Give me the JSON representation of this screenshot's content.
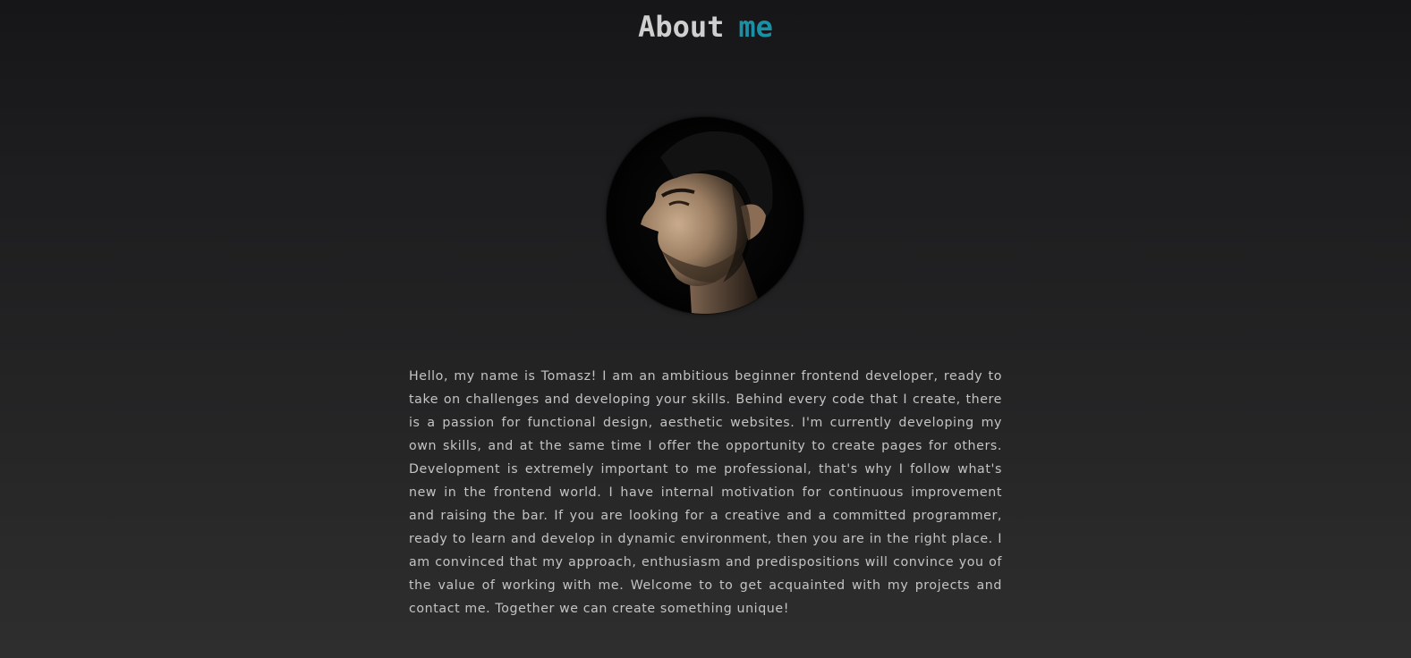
{
  "header": {
    "title_main": "About",
    "title_accent": "me"
  },
  "colors": {
    "accent": "#1a8fa6",
    "title": "#cfcfcf",
    "text": "#c4c4c4",
    "background_top": "#161618",
    "background_bottom": "#2e2e2e"
  },
  "portrait": {
    "icon": "profile-photo"
  },
  "bio": {
    "text": "Hello, my name is Tomasz! I am an ambitious beginner frontend developer, ready to take on challenges and developing your skills. Behind every code that I create, there is a passion for functional design, aesthetic websites. I'm currently developing my own skills, and at the same time I offer the opportunity to create pages for others. Development is extremely important to me professional, that's why I follow what's new in the frontend world. I have internal motivation for continuous improvement and raising the bar. If you are looking for a creative and a committed programmer, ready to learn and develop in dynamic environment, then you are in the right place. I am convinced that my approach, enthusiasm and predispositions will convince you of the value of working with me. Welcome to to get acquainted with my projects and contact me. Together we can create something unique!"
  }
}
